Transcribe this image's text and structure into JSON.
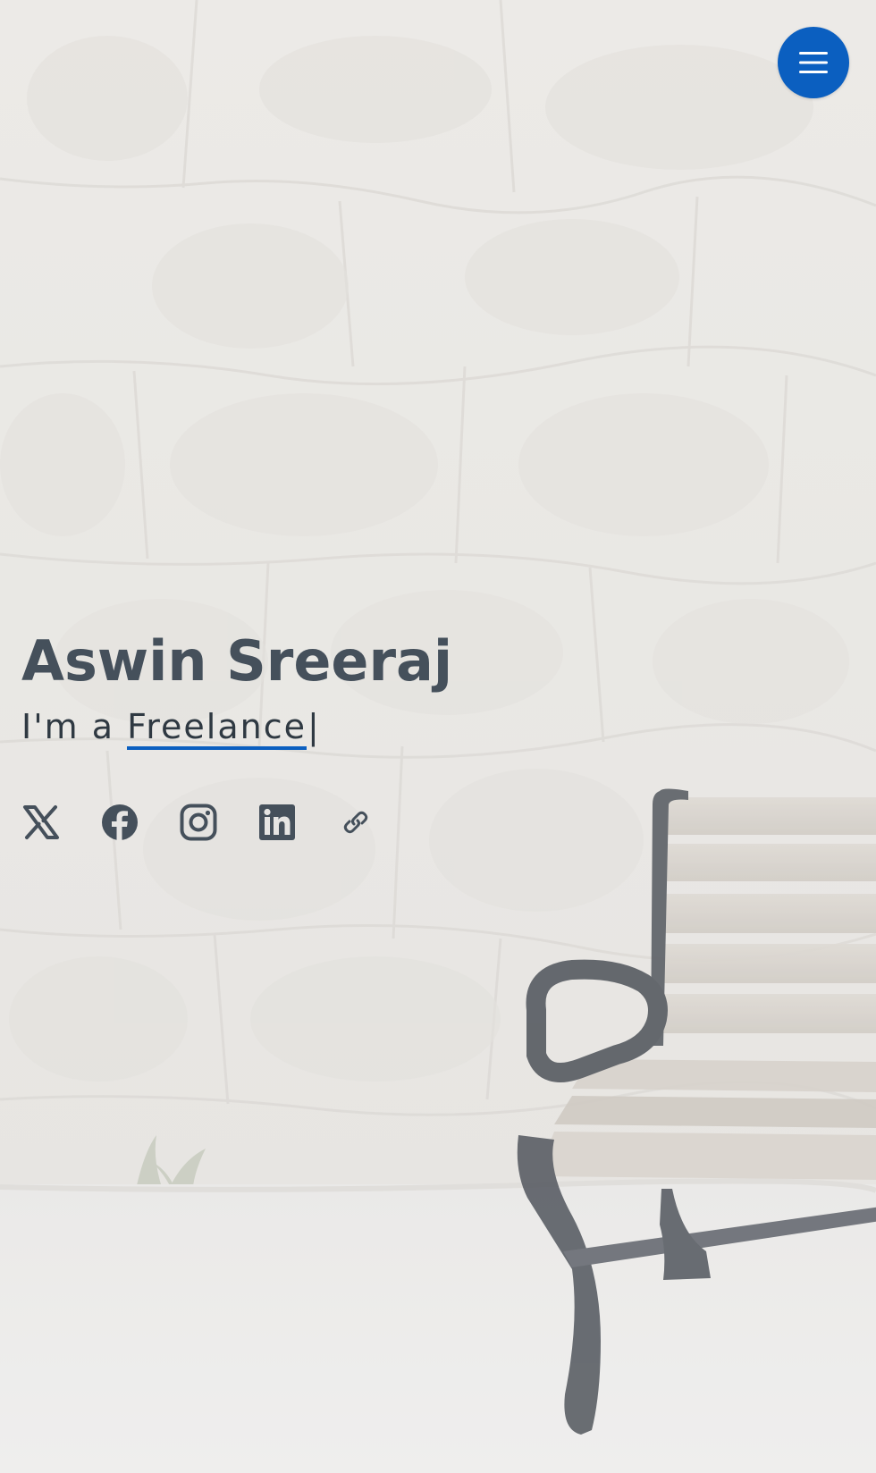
{
  "header": {
    "menu_toggle_label": "Open navigation menu"
  },
  "hero": {
    "name": "Aswin Sreeraj",
    "typed_prefix": "I'm a ",
    "typed_word": "Freelance",
    "typed_cursor": "|"
  },
  "social": {
    "items": [
      {
        "icon": "x-twitter-icon",
        "label": "X"
      },
      {
        "icon": "facebook-icon",
        "label": "Facebook"
      },
      {
        "icon": "instagram-icon",
        "label": "Instagram"
      },
      {
        "icon": "linkedin-icon",
        "label": "LinkedIn"
      },
      {
        "icon": "link-icon",
        "label": "Link"
      }
    ]
  },
  "colors": {
    "accent": "#0b5fc0",
    "text_heading": "#45505b",
    "text_body": "#2f3942",
    "background": "#e9e8e6"
  }
}
